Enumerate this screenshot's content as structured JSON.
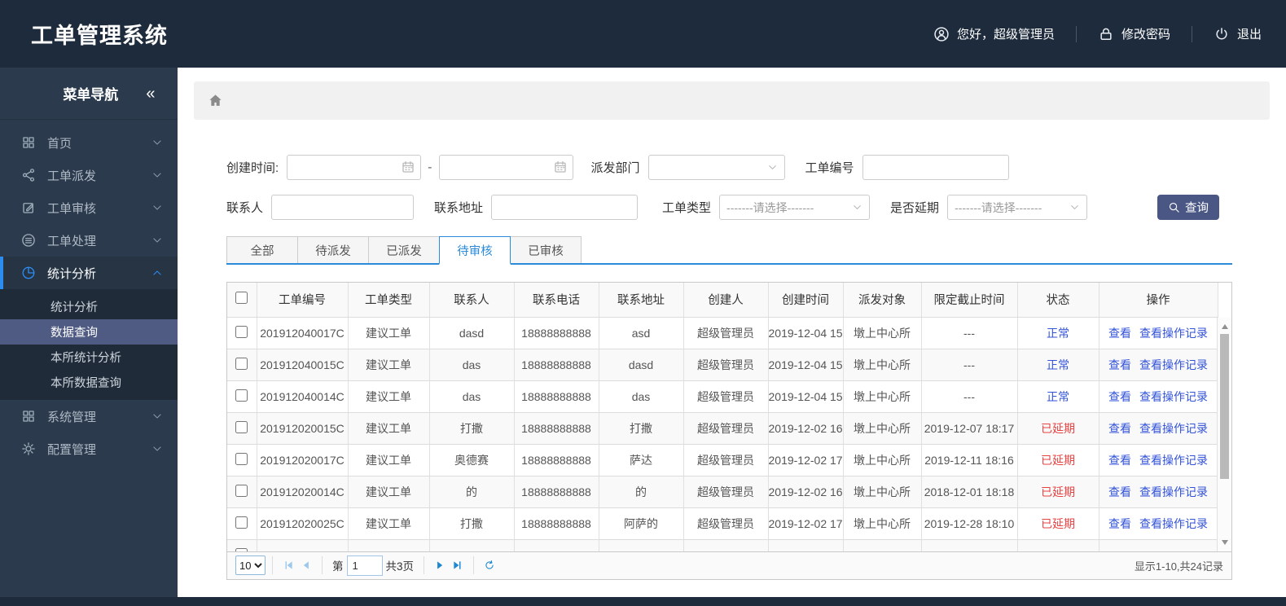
{
  "header": {
    "title": "工单管理系统",
    "greeting": "您好，超级管理员",
    "change_password": "修改密码",
    "logout": "退出"
  },
  "sidebar": {
    "title": "菜单导航",
    "collapse_glyph": "《",
    "items": [
      {
        "label": "首页",
        "icon": "grid"
      },
      {
        "label": "工单派发",
        "icon": "share"
      },
      {
        "label": "工单审核",
        "icon": "edit"
      },
      {
        "label": "工单处理",
        "icon": "discs"
      },
      {
        "label": "统计分析",
        "icon": "pie",
        "active": true,
        "expanded": true
      },
      {
        "label": "系统管理",
        "icon": "grid"
      },
      {
        "label": "配置管理",
        "icon": "gear"
      }
    ],
    "submenu": [
      {
        "label": "统计分析"
      },
      {
        "label": "数据查询",
        "active": true
      },
      {
        "label": "本所统计分析"
      },
      {
        "label": "本所数据查询"
      }
    ]
  },
  "filters": {
    "created_time_label": "创建时间:",
    "range_separator": "-",
    "dispatch_dept_label": "派发部门",
    "order_no_label": "工单编号",
    "contact_label": "联系人",
    "contact_address_label": "联系地址",
    "order_type_label": "工单类型",
    "order_type_placeholder": "-------请选择-------",
    "overdue_label": "是否延期",
    "overdue_placeholder": "-------请选择-------",
    "search_button": "查询"
  },
  "tabs": {
    "items": [
      "全部",
      "待派发",
      "已派发",
      "待审核",
      "已审核"
    ],
    "active_index": 3
  },
  "table": {
    "headers": [
      "工单编号",
      "工单类型",
      "联系人",
      "联系电话",
      "联系地址",
      "创建人",
      "创建时间",
      "派发对象",
      "限定截止时间",
      "状态",
      "操作"
    ],
    "action_labels": [
      "查看",
      "查看操作记录"
    ],
    "rows": [
      {
        "order_no": "201912040017C",
        "type": "建议工单",
        "contact": "dasd",
        "phone": "18888888888",
        "address": "asd",
        "creator": "超级管理员",
        "created": "2019-12-04 15",
        "target": "墩上中心所",
        "deadline": "---",
        "status": "正常",
        "status_state": "normal"
      },
      {
        "order_no": "201912040015C",
        "type": "建议工单",
        "contact": "das",
        "phone": "18888888888",
        "address": "dasd",
        "creator": "超级管理员",
        "created": "2019-12-04 15",
        "target": "墩上中心所",
        "deadline": "---",
        "status": "正常",
        "status_state": "normal"
      },
      {
        "order_no": "201912040014C",
        "type": "建议工单",
        "contact": "das",
        "phone": "18888888888",
        "address": "das",
        "creator": "超级管理员",
        "created": "2019-12-04 15",
        "target": "墩上中心所",
        "deadline": "---",
        "status": "正常",
        "status_state": "normal"
      },
      {
        "order_no": "201912020015C",
        "type": "建议工单",
        "contact": "打撒",
        "phone": "18888888888",
        "address": "打撒",
        "creator": "超级管理员",
        "created": "2019-12-02 16",
        "target": "墩上中心所",
        "deadline": "2019-12-07 18:17",
        "status": "已延期",
        "status_state": "overdue"
      },
      {
        "order_no": "201912020017C",
        "type": "建议工单",
        "contact": "奥德赛",
        "phone": "18888888888",
        "address": "萨达",
        "creator": "超级管理员",
        "created": "2019-12-02 17",
        "target": "墩上中心所",
        "deadline": "2019-12-11 18:16",
        "status": "已延期",
        "status_state": "overdue"
      },
      {
        "order_no": "201912020014C",
        "type": "建议工单",
        "contact": "的",
        "phone": "18888888888",
        "address": "的",
        "creator": "超级管理员",
        "created": "2019-12-02 16",
        "target": "墩上中心所",
        "deadline": "2018-12-01 18:18",
        "status": "已延期",
        "status_state": "overdue"
      },
      {
        "order_no": "201912020025C",
        "type": "建议工单",
        "contact": "打撒",
        "phone": "18888888888",
        "address": "阿萨的",
        "creator": "超级管理员",
        "created": "2019-12-02 17",
        "target": "墩上中心所",
        "deadline": "2019-12-28 18:10",
        "status": "已延期",
        "status_state": "overdue"
      },
      {
        "order_no": "",
        "type": "",
        "contact": "",
        "phone": "",
        "address": "",
        "creator": "",
        "created": "",
        "target": "",
        "deadline": "",
        "status": "",
        "status_state": "",
        "partial": true
      }
    ]
  },
  "pagination": {
    "page_size": "10",
    "page_prefix": "第",
    "current_page": "1",
    "total_pages_label": "共3页",
    "summary": "显示1-10,共24记录"
  },
  "colors": {
    "header_bg": "#1e2b3c",
    "sidebar_bg": "#2b3a4c",
    "accent_blue": "#2d8cf0",
    "tab_blue": "#2b8bd9",
    "link_blue": "#3353d8",
    "status_normal": "#3353d8",
    "status_overdue": "#e64242",
    "submenu_active_bg": "#4f5b82",
    "search_button_bg": "#4a5784"
  }
}
